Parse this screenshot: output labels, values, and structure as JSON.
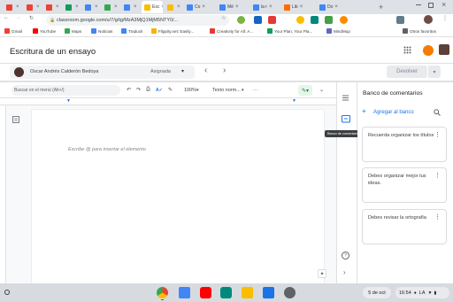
{
  "browser": {
    "tabs": [
      {
        "label": "",
        "color": "#ea4335"
      },
      {
        "label": "",
        "color": "#ea4335"
      },
      {
        "label": "",
        "color": "#ea4335"
      },
      {
        "label": "",
        "color": "#0f9d58"
      },
      {
        "label": "",
        "color": "#4285f4"
      },
      {
        "label": "",
        "color": "#34a853"
      },
      {
        "label": "",
        "color": "#4285f4"
      },
      {
        "label": "Esc",
        "color": "#fbbc04"
      },
      {
        "label": "",
        "color": "#fbbc04"
      },
      {
        "label": "Co",
        "color": "#4285f4"
      },
      {
        "label": "Mé",
        "color": "#4285f4"
      },
      {
        "label": "la r",
        "color": "#4285f4"
      },
      {
        "label": "Lib",
        "color": "#ff6d00"
      },
      {
        "label": "Do",
        "color": "#4285f4"
      }
    ],
    "new_tab": "+",
    "url": "classroom.google.com/u/7/g/tg/MzA3MjQ1MjM5NTY0/...",
    "bookmarks": [
      {
        "label": "Gmail",
        "color": "#ea4335"
      },
      {
        "label": "YouTube",
        "color": "#ff0000"
      },
      {
        "label": "Maps",
        "color": "#34a853"
      },
      {
        "label": "Noticias",
        "color": "#4285f4"
      },
      {
        "label": "Traduck",
        "color": "#4285f4"
      },
      {
        "label": "Flippity.net: Easily...",
        "color": "#f4b400"
      },
      {
        "label": "Creativity for All: A...",
        "color": "#e53935"
      },
      {
        "label": "Your Plan, Your Pla...",
        "color": "#0f9d58"
      },
      {
        "label": "MindMup",
        "color": "#5c6bc0"
      }
    ],
    "other_bookmarks": "Otros favoritos"
  },
  "app": {
    "title": "Escritura de un ensayo",
    "student_name": "Oscar Andrés Calderón Bedoya",
    "status": "Asignada",
    "return_button": "Devolver"
  },
  "toolbar": {
    "search_placeholder": "Buscar en el menú (Alt+/)",
    "zoom": "100%",
    "style": "Texto norm...",
    "more": "···"
  },
  "document": {
    "placeholder": "Escribe @ para insertar el elemento"
  },
  "comment_bank": {
    "title": "Banco de comentarios",
    "add_label": "Agregar al banco",
    "tooltip": "Banco de comentarios",
    "comments": [
      {
        "text": "Recuerda organizar los títulos"
      },
      {
        "text": "Debes organizar mejor tus ideas."
      },
      {
        "text": "Debes revisar la ortografía"
      }
    ]
  },
  "shelf": {
    "date": "5 de oct",
    "time": "16:54",
    "locale": "LA"
  }
}
